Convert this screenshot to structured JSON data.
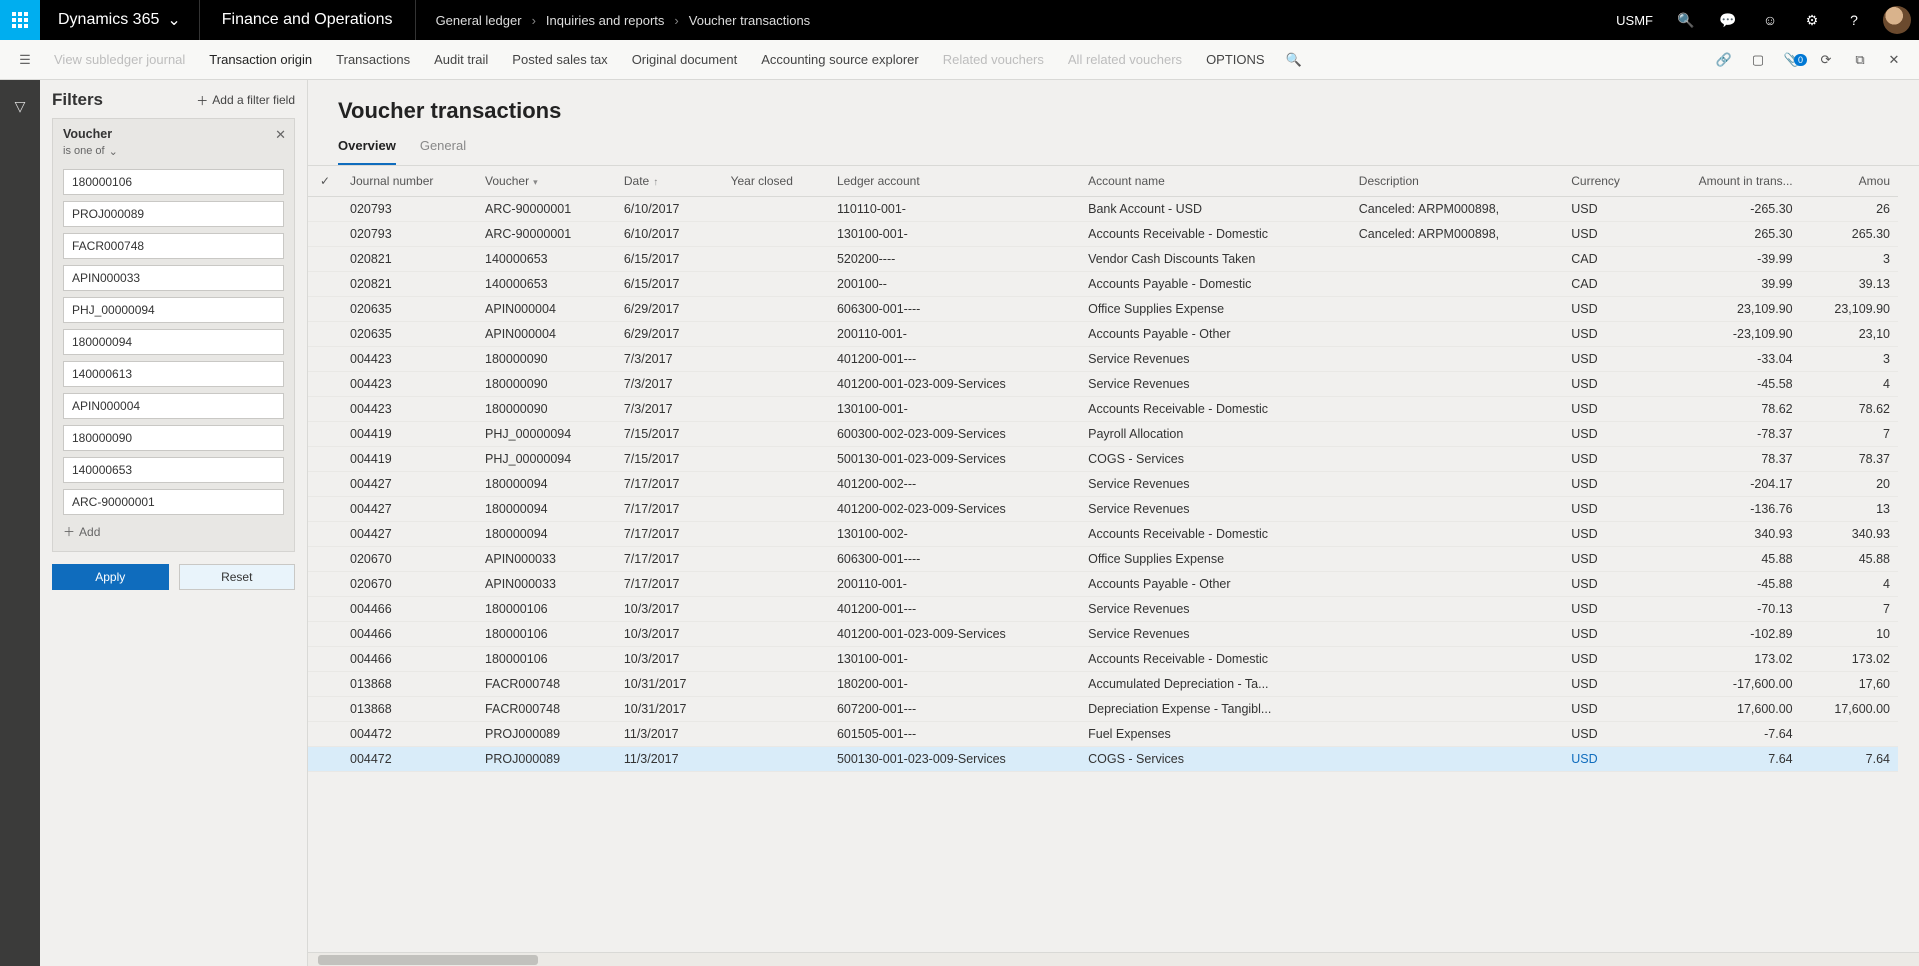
{
  "topbar": {
    "brand": "Dynamics 365",
    "module": "Finance and Operations",
    "crumbs": [
      "General ledger",
      "Inquiries and reports",
      "Voucher transactions"
    ],
    "company": "USMF"
  },
  "actionbar": {
    "view_subledger": "View subledger journal",
    "transaction_origin": "Transaction origin",
    "transactions": "Transactions",
    "audit_trail": "Audit trail",
    "posted_sales_tax": "Posted sales tax",
    "original_document": "Original document",
    "accounting_source": "Accounting source explorer",
    "related_vouchers": "Related vouchers",
    "all_related_vouchers": "All related vouchers",
    "options": "OPTIONS",
    "attach_count": "0"
  },
  "filters": {
    "title": "Filters",
    "add_field": "Add a filter field",
    "box_title": "Voucher",
    "op": "is one of",
    "values": [
      "180000106",
      "PROJ000089",
      "FACR000748",
      "APIN000033",
      "PHJ_00000094",
      "180000094",
      "140000613",
      "APIN000004",
      "180000090",
      "140000653",
      "ARC-90000001"
    ],
    "add_value": "Add",
    "apply": "Apply",
    "reset": "Reset"
  },
  "page": {
    "title": "Voucher transactions",
    "tab_overview": "Overview",
    "tab_general": "General"
  },
  "columns": {
    "journal": "Journal number",
    "voucher": "Voucher",
    "date": "Date",
    "year_closed": "Year closed",
    "ledger": "Ledger account",
    "account_name": "Account name",
    "description": "Description",
    "currency": "Currency",
    "amount_trans": "Amount in trans...",
    "amount": "Amou"
  },
  "rows": [
    {
      "j": "020793",
      "v": "ARC-90000001",
      "d": "6/10/2017",
      "l": "110110-001-",
      "n": "Bank Account - USD",
      "desc": "Canceled: ARPM000898,",
      "c": "USD",
      "a1": "-265.30",
      "a2": "26"
    },
    {
      "j": "020793",
      "v": "ARC-90000001",
      "d": "6/10/2017",
      "l": "130100-001-",
      "n": "Accounts Receivable - Domestic",
      "desc": "Canceled: ARPM000898,",
      "c": "USD",
      "a1": "265.30",
      "a2": "265.30"
    },
    {
      "j": "020821",
      "v": "140000653",
      "d": "6/15/2017",
      "l": "520200----",
      "n": "Vendor Cash Discounts Taken",
      "desc": "",
      "c": "CAD",
      "a1": "-39.99",
      "a2": "3"
    },
    {
      "j": "020821",
      "v": "140000653",
      "d": "6/15/2017",
      "l": "200100--",
      "n": "Accounts Payable - Domestic",
      "desc": "",
      "c": "CAD",
      "a1": "39.99",
      "a2": "39.13"
    },
    {
      "j": "020635",
      "v": "APIN000004",
      "d": "6/29/2017",
      "l": "606300-001----",
      "n": "Office Supplies Expense",
      "desc": "",
      "c": "USD",
      "a1": "23,109.90",
      "a2": "23,109.90"
    },
    {
      "j": "020635",
      "v": "APIN000004",
      "d": "6/29/2017",
      "l": "200110-001-",
      "n": "Accounts Payable - Other",
      "desc": "",
      "c": "USD",
      "a1": "-23,109.90",
      "a2": "23,10"
    },
    {
      "j": "004423",
      "v": "180000090",
      "d": "7/3/2017",
      "l": "401200-001---",
      "n": "Service Revenues",
      "desc": "",
      "c": "USD",
      "a1": "-33.04",
      "a2": "3"
    },
    {
      "j": "004423",
      "v": "180000090",
      "d": "7/3/2017",
      "l": "401200-001-023-009-Services",
      "n": "Service Revenues",
      "desc": "",
      "c": "USD",
      "a1": "-45.58",
      "a2": "4"
    },
    {
      "j": "004423",
      "v": "180000090",
      "d": "7/3/2017",
      "l": "130100-001-",
      "n": "Accounts Receivable - Domestic",
      "desc": "",
      "c": "USD",
      "a1": "78.62",
      "a2": "78.62"
    },
    {
      "j": "004419",
      "v": "PHJ_00000094",
      "d": "7/15/2017",
      "l": "600300-002-023-009-Services",
      "n": "Payroll Allocation",
      "desc": "",
      "c": "USD",
      "a1": "-78.37",
      "a2": "7"
    },
    {
      "j": "004419",
      "v": "PHJ_00000094",
      "d": "7/15/2017",
      "l": "500130-001-023-009-Services",
      "n": "COGS - Services",
      "desc": "",
      "c": "USD",
      "a1": "78.37",
      "a2": "78.37"
    },
    {
      "j": "004427",
      "v": "180000094",
      "d": "7/17/2017",
      "l": "401200-002---",
      "n": "Service Revenues",
      "desc": "",
      "c": "USD",
      "a1": "-204.17",
      "a2": "20"
    },
    {
      "j": "004427",
      "v": "180000094",
      "d": "7/17/2017",
      "l": "401200-002-023-009-Services",
      "n": "Service Revenues",
      "desc": "",
      "c": "USD",
      "a1": "-136.76",
      "a2": "13"
    },
    {
      "j": "004427",
      "v": "180000094",
      "d": "7/17/2017",
      "l": "130100-002-",
      "n": "Accounts Receivable - Domestic",
      "desc": "",
      "c": "USD",
      "a1": "340.93",
      "a2": "340.93"
    },
    {
      "j": "020670",
      "v": "APIN000033",
      "d": "7/17/2017",
      "l": "606300-001----",
      "n": "Office Supplies Expense",
      "desc": "",
      "c": "USD",
      "a1": "45.88",
      "a2": "45.88"
    },
    {
      "j": "020670",
      "v": "APIN000033",
      "d": "7/17/2017",
      "l": "200110-001-",
      "n": "Accounts Payable - Other",
      "desc": "",
      "c": "USD",
      "a1": "-45.88",
      "a2": "4"
    },
    {
      "j": "004466",
      "v": "180000106",
      "d": "10/3/2017",
      "l": "401200-001---",
      "n": "Service Revenues",
      "desc": "",
      "c": "USD",
      "a1": "-70.13",
      "a2": "7"
    },
    {
      "j": "004466",
      "v": "180000106",
      "d": "10/3/2017",
      "l": "401200-001-023-009-Services",
      "n": "Service Revenues",
      "desc": "",
      "c": "USD",
      "a1": "-102.89",
      "a2": "10"
    },
    {
      "j": "004466",
      "v": "180000106",
      "d": "10/3/2017",
      "l": "130100-001-",
      "n": "Accounts Receivable - Domestic",
      "desc": "",
      "c": "USD",
      "a1": "173.02",
      "a2": "173.02"
    },
    {
      "j": "013868",
      "v": "FACR000748",
      "d": "10/31/2017",
      "l": "180200-001-",
      "n": "Accumulated Depreciation - Ta...",
      "desc": "",
      "c": "USD",
      "a1": "-17,600.00",
      "a2": "17,60"
    },
    {
      "j": "013868",
      "v": "FACR000748",
      "d": "10/31/2017",
      "l": "607200-001---",
      "n": "Depreciation Expense - Tangibl...",
      "desc": "",
      "c": "USD",
      "a1": "17,600.00",
      "a2": "17,600.00"
    },
    {
      "j": "004472",
      "v": "PROJ000089",
      "d": "11/3/2017",
      "l": "601505-001---",
      "n": "Fuel Expenses",
      "desc": "",
      "c": "USD",
      "a1": "-7.64",
      "a2": ""
    },
    {
      "j": "004472",
      "v": "PROJ000089",
      "d": "11/3/2017",
      "l": "500130-001-023-009-Services",
      "n": "COGS - Services",
      "desc": "",
      "c": "USD",
      "a1": "7.64",
      "a2": "7.64",
      "sel": true
    }
  ]
}
